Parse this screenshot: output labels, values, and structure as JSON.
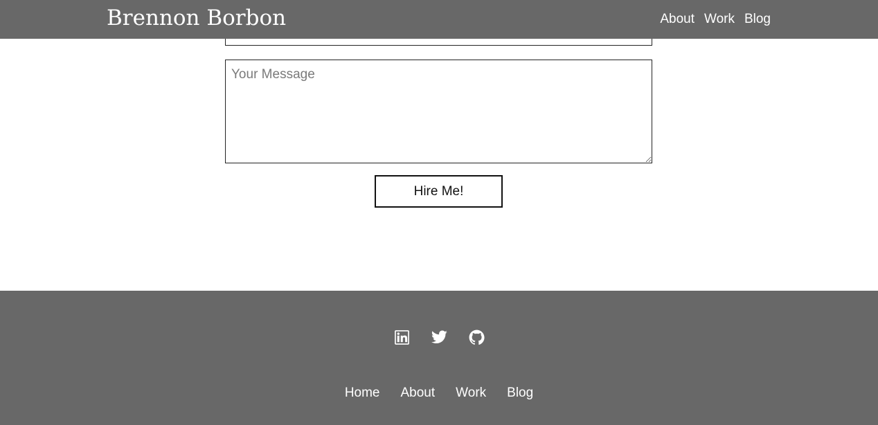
{
  "header": {
    "brand": "Brennon Borbon",
    "nav": [
      "About",
      "Work",
      "Blog"
    ]
  },
  "form": {
    "message_placeholder": "Your Message",
    "submit_label": "Hire Me!"
  },
  "footer": {
    "social_icons": [
      "linkedin-icon",
      "twitter-icon",
      "github-icon"
    ],
    "nav": [
      "Home",
      "About",
      "Work",
      "Blog"
    ]
  },
  "colors": {
    "header_bg": "#686868",
    "footer_bg": "#686868",
    "text_light": "#ffffff"
  }
}
